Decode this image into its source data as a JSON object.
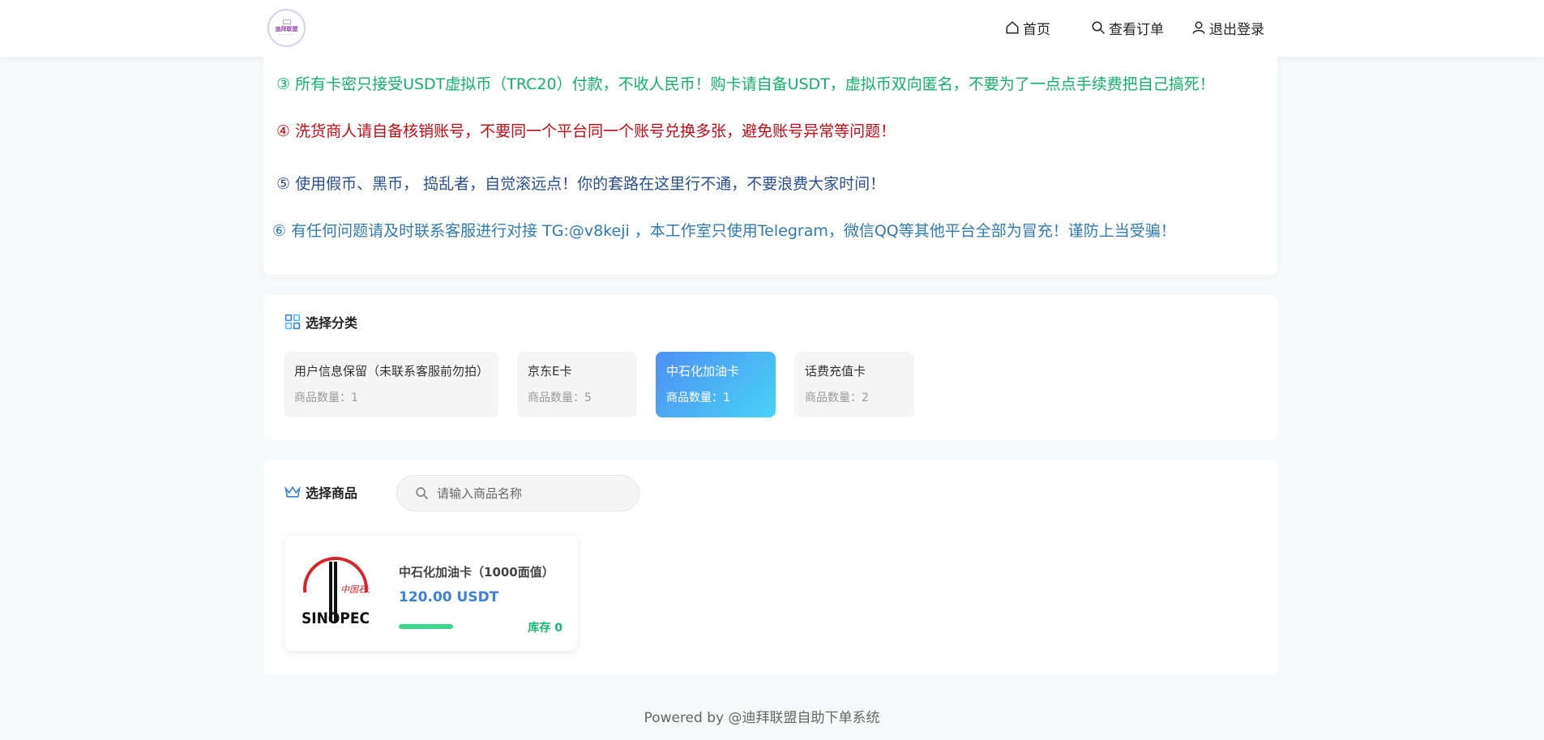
{
  "header": {
    "logo_text": "迪拜联盟",
    "nav": {
      "home": "首页",
      "orders": "查看订单",
      "logout": "退出登录"
    }
  },
  "notices": {
    "n3": "③  所有卡密只接受USDT虚拟币（TRC20）付款，不收人民币！购卡请自备USDT，虚拟币双向匿名，不要为了一点点手续费把自己搞死！",
    "n4": "④  洗货商人请自备核销账号，不要同一个平台同一个账号兑换多张，避免账号异常等问题！",
    "n5": "⑤  使用假币、黑币， 捣乱者，自觉滚远点！你的套路在这里行不通，不要浪费大家时间！",
    "n6": "⑥  有任何问题请及时联系客服进行对接  TG:@v8keji ，本工作室只使用Telegram，微信QQ等其他平台全部为冒充！谨防上当受骗！",
    "colors": {
      "green": "#13b06b",
      "red": "#c40b17",
      "navy": "#2a4f8f",
      "blue": "#2f7bb0"
    }
  },
  "categories": {
    "title": "选择分类",
    "items": [
      {
        "name": "用户信息保留（未联系客服前勿拍）",
        "count": "商品数量：1"
      },
      {
        "name": "京东E卡",
        "count": "商品数量：5"
      },
      {
        "name": "中石化加油卡",
        "count": "商品数量：1",
        "active": true
      },
      {
        "name": "话费充值卡",
        "count": "商品数量：2"
      }
    ]
  },
  "goods": {
    "title": "选择商品",
    "search_placeholder": "请输入商品名称",
    "products": [
      {
        "name": "中石化加油卡（1000面值）",
        "price": "120.00 USDT",
        "stock": "库存 0",
        "stock_level": 1.0,
        "logo_text": "中国石化",
        "logo_brand": "SINOPEC"
      }
    ]
  },
  "footer": "Powered by @迪拜联盟自助下单系统",
  "accent_colors": {
    "active_gradient_start": "#4e8ff5",
    "active_gradient_end": "#49d3f4",
    "price": "#3b82d6",
    "stock": "#16b56d"
  }
}
